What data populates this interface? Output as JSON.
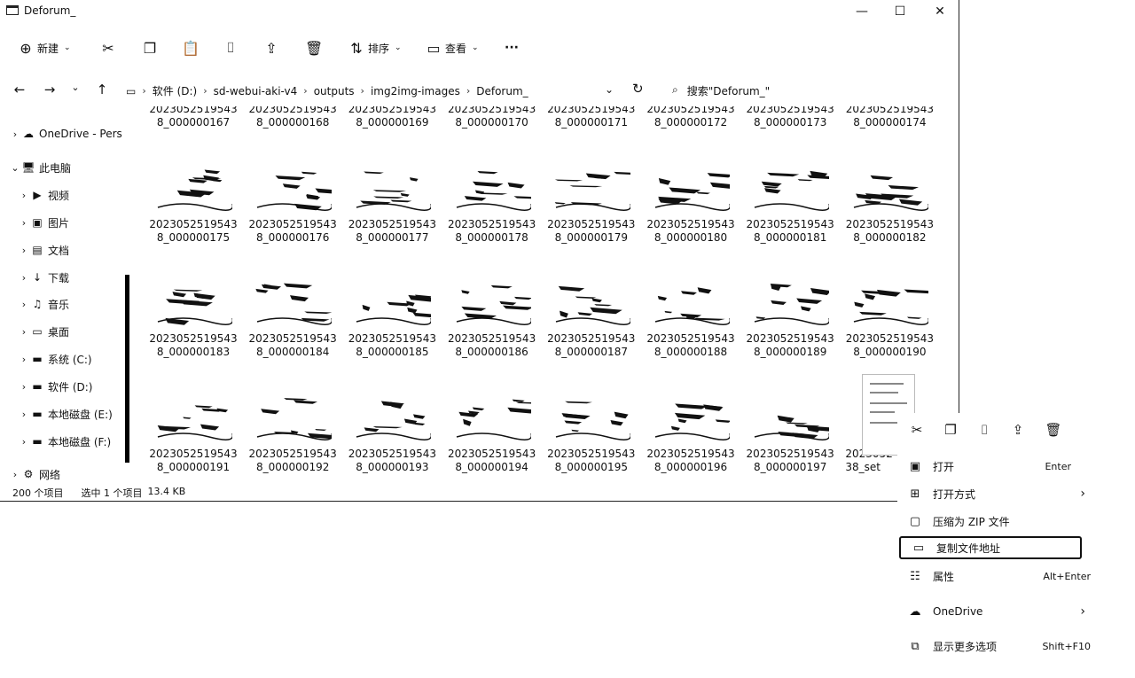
{
  "window": {
    "title": "Deforum_",
    "minimize": "—",
    "maximize": "☐",
    "close": "✕"
  },
  "toolbar": {
    "new_label": "新建",
    "sort_label": "排序",
    "view_label": "查看",
    "more": "···"
  },
  "address": {
    "crumbs": [
      "软件 (D:)",
      "sd-webui-aki-v4",
      "outputs",
      "img2img-images",
      "Deforum_"
    ],
    "search_placeholder": "搜索\"Deforum_\""
  },
  "sidebar": {
    "items": [
      {
        "label": "OneDrive - Pers",
        "icon": "☁"
      },
      {
        "label": "此电脑",
        "icon": "🖥"
      },
      {
        "label": "视频",
        "icon": "▶"
      },
      {
        "label": "图片",
        "icon": "▣"
      },
      {
        "label": "文档",
        "icon": "▤"
      },
      {
        "label": "下载",
        "icon": "↓"
      },
      {
        "label": "音乐",
        "icon": "♫"
      },
      {
        "label": "桌面",
        "icon": "▭"
      },
      {
        "label": "系统 (C:)",
        "icon": "▬"
      },
      {
        "label": "软件 (D:)",
        "icon": "▬"
      },
      {
        "label": "本地磁盘 (E:)",
        "icon": "▬"
      },
      {
        "label": "本地磁盘 (F:)",
        "icon": "▬"
      },
      {
        "label": "网络",
        "icon": "⚙"
      }
    ]
  },
  "files": {
    "rows": [
      [
        "2023052519543 8_000000167",
        "2023052519543 8_000000168",
        "2023052519543 8_000000169",
        "2023052519543 8_000000170",
        "2023052519543 8_000000171",
        "2023052519543 8_000000172",
        "2023052519543 8_000000173",
        "2023052519543 8_000000174"
      ],
      [
        "2023052519543 8_000000175",
        "2023052519543 8_000000176",
        "2023052519543 8_000000177",
        "2023052519543 8_000000178",
        "2023052519543 8_000000179",
        "2023052519543 8_000000180",
        "2023052519543 8_000000181",
        "2023052519543 8_000000182"
      ],
      [
        "2023052519543 8_000000183",
        "2023052519543 8_000000184",
        "2023052519543 8_000000185",
        "2023052519543 8_000000186",
        "2023052519543 8_000000187",
        "2023052519543 8_000000188",
        "2023052519543 8_000000189",
        "2023052519543 8_000000190"
      ],
      [
        "2023052519543 8_000000191",
        "2023052519543 8_000000192",
        "2023052519543 8_000000193",
        "2023052519543 8_000000194",
        "2023052519543 8_000000195",
        "2023052519543 8_000000196",
        "2023052519543 8_000000197",
        "2023052 38_set"
      ]
    ]
  },
  "status": {
    "count": "200 个项目",
    "selection": "选中 1 个项目",
    "size": "13.4 KB"
  },
  "context_menu": {
    "items": [
      {
        "label": "打开",
        "shortcut": "Enter",
        "icon": "▣"
      },
      {
        "label": "打开方式",
        "shortcut": "",
        "icon": "⊞",
        "submenu": "›"
      },
      {
        "label": "压缩为 ZIP 文件",
        "shortcut": "",
        "icon": "▢"
      },
      {
        "label": "复制文件地址",
        "shortcut": "",
        "icon": "▭"
      },
      {
        "label": "属性",
        "shortcut": "Alt+Enter",
        "icon": "☷"
      },
      {
        "label": "OneDrive",
        "shortcut": "",
        "icon": "☁",
        "submenu": "›"
      },
      {
        "label": "显示更多选项",
        "shortcut": "Shift+F10",
        "icon": "⧉"
      }
    ]
  }
}
